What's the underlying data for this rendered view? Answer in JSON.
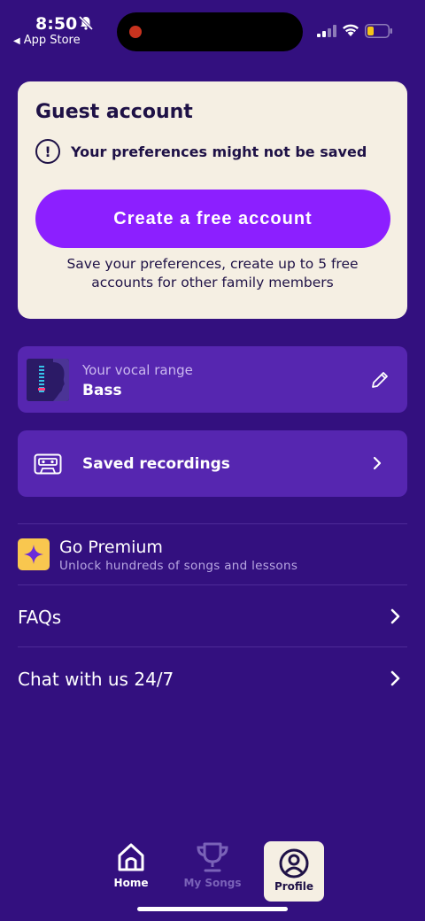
{
  "status_bar": {
    "time": "8:50",
    "back_label": "App Store"
  },
  "guest_card": {
    "title": "Guest account",
    "warning": "Your preferences might not be saved",
    "button_label": "Create a free account",
    "note": "Save your preferences, create up to 5 free accounts for other family members"
  },
  "vocal_range": {
    "label": "Your vocal range",
    "value": "Bass"
  },
  "saved_recordings": {
    "label": "Saved recordings"
  },
  "premium": {
    "title": "Go Premium",
    "subtitle": "Unlock hundreds of songs and lessons"
  },
  "menu": {
    "faqs": "FAQs",
    "chat": "Chat with us 24/7"
  },
  "tabs": {
    "home": "Home",
    "songs": "My Songs",
    "profile": "Profile"
  },
  "colors": {
    "background": "#33107f",
    "card_cream": "#f5efe3",
    "accent_purple": "#8c1fff",
    "card_purple": "#5626b0",
    "premium_yellow": "#f9c74f"
  }
}
